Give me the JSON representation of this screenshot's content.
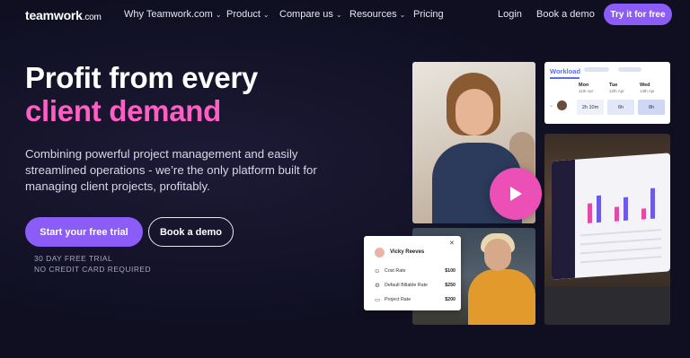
{
  "nav": {
    "logo": "teamwork",
    "logo_suffix": ".com",
    "items": [
      {
        "label": "Why Teamwork.com",
        "dropdown": true
      },
      {
        "label": "Product",
        "dropdown": true
      },
      {
        "label": "Compare us",
        "dropdown": true
      },
      {
        "label": "Resources",
        "dropdown": true
      },
      {
        "label": "Pricing",
        "dropdown": false
      }
    ],
    "login": "Login",
    "book_demo": "Book a demo",
    "try_free": "Try it for free"
  },
  "hero": {
    "headline_line1": "Profit from every",
    "headline_line2": "client demand",
    "subtext": "Combining powerful project management and easily streamlined operations - we’re the only platform built for managing client projects, profitably.",
    "primary_cta": "Start your free trial",
    "secondary_cta": "Book a demo",
    "note_line1": "30 DAY FREE TRIAL",
    "note_line2": "NO CREDIT CARD REQUIRED"
  },
  "workload": {
    "title": "Workload",
    "days": [
      {
        "day": "Mon",
        "date": "11th Apr",
        "hours": "2h 10m"
      },
      {
        "day": "Tue",
        "date": "12th Apr",
        "hours": "6h"
      },
      {
        "day": "Wed",
        "date": "13th Apr",
        "hours": "8h"
      }
    ]
  },
  "rates": {
    "name": "Vicky Reeves",
    "rows": [
      {
        "icon": "cost-icon",
        "label": "Cost Rate",
        "value": "$100"
      },
      {
        "icon": "billable-icon",
        "label": "Default Billable Rate",
        "value": "$250"
      },
      {
        "icon": "folder-icon",
        "label": "Project Rate",
        "value": "$200"
      }
    ]
  },
  "colors": {
    "background": "#0f0f21",
    "accent_purple": "#8b5cf6",
    "accent_pink": "#ff5fc4",
    "play_pink": "#ec4fb6"
  }
}
